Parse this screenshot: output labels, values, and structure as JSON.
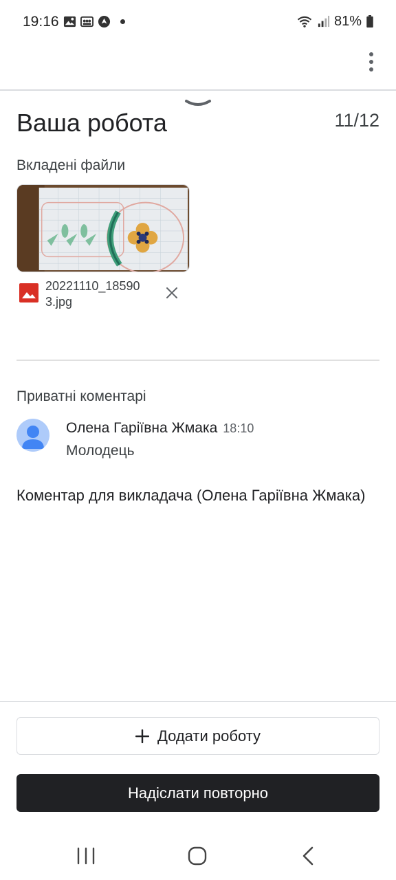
{
  "status_bar": {
    "time": "19:16",
    "battery": "81%",
    "left_icons": [
      "image-icon",
      "gallery-icon",
      "navigation-icon"
    ],
    "right_icons": [
      "wifi-icon",
      "signal-icon",
      "battery-icon"
    ]
  },
  "header": {
    "title": "Ваша робота",
    "counter": "11/12",
    "menu_icon": "more-vert-icon"
  },
  "attachments": {
    "label": "Вкладені файли",
    "files": [
      {
        "name": "20221110_185903.jpg",
        "type_icon": "image-file-icon",
        "remove_icon": "close-icon"
      }
    ]
  },
  "comments": {
    "label": "Приватні коментарі",
    "items": [
      {
        "author": "Олена Гаріївна Жмака",
        "time": "18:10",
        "text": "Молодець"
      }
    ],
    "input_label": "Коментар для викладача (Олена Гаріївна Жмака)"
  },
  "actions": {
    "add_work": "Додати роботу",
    "resubmit": "Надіслати повторно"
  },
  "colors": {
    "primary_button": "#202124",
    "file_icon": "#d93025",
    "avatar_bg": "#aecbfa",
    "avatar_fg": "#4285f4"
  }
}
